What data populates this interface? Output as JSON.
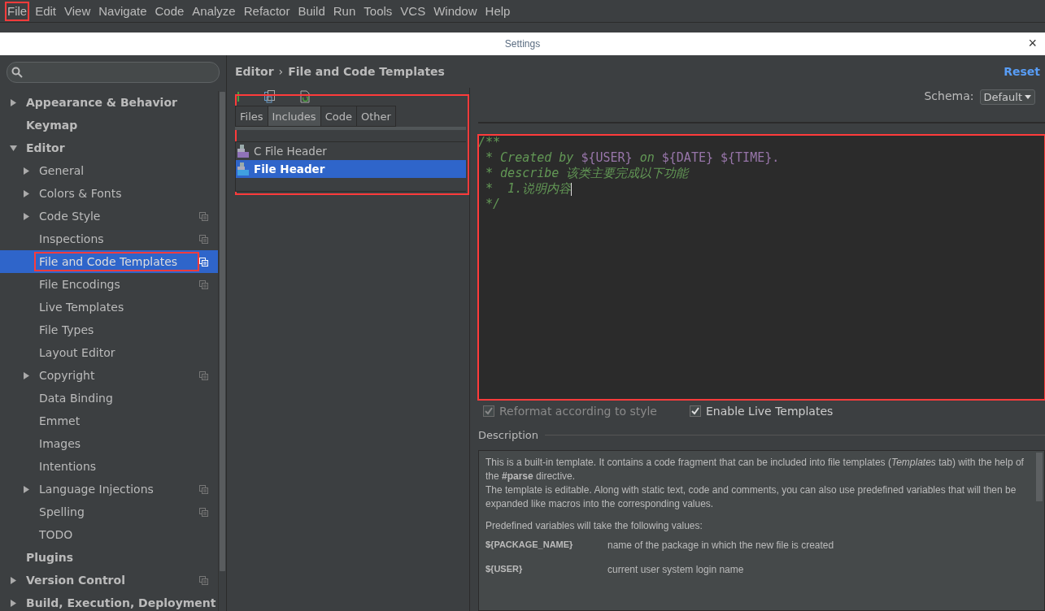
{
  "menu_bar": [
    {
      "label": "File",
      "highlighted": true
    },
    {
      "label": "Edit",
      "highlighted": false
    },
    {
      "label": "View",
      "highlighted": false
    },
    {
      "label": "Navigate",
      "highlighted": false
    },
    {
      "label": "Code",
      "highlighted": false
    },
    {
      "label": "Analyze",
      "highlighted": false
    },
    {
      "label": "Refactor",
      "highlighted": false
    },
    {
      "label": "Build",
      "highlighted": false
    },
    {
      "label": "Run",
      "highlighted": false
    },
    {
      "label": "Tools",
      "highlighted": false
    },
    {
      "label": "VCS",
      "highlighted": false
    },
    {
      "label": "Window",
      "highlighted": false
    },
    {
      "label": "Help",
      "highlighted": false
    }
  ],
  "dialog": {
    "title": "Settings",
    "close": "×"
  },
  "sidebar": {
    "items": [
      {
        "label": "Appearance & Behavior",
        "expanded": false,
        "selected": false,
        "project_icon": false,
        "highlighted": false
      },
      {
        "label": "Keymap",
        "selected": false,
        "project_icon": false,
        "highlighted": false
      },
      {
        "label": "Editor",
        "expanded": true,
        "selected": false,
        "project_icon": false,
        "highlighted": false,
        "children": [
          {
            "label": "General",
            "expanded": false,
            "selected": false,
            "project_icon": false,
            "highlighted": false
          },
          {
            "label": "Colors & Fonts",
            "expanded": false,
            "selected": false,
            "project_icon": false,
            "highlighted": false
          },
          {
            "label": "Code Style",
            "expanded": false,
            "selected": false,
            "project_icon": true,
            "highlighted": false
          },
          {
            "label": "Inspections",
            "selected": false,
            "project_icon": true,
            "highlighted": false
          },
          {
            "label": "File and Code Templates",
            "selected": true,
            "project_icon": true,
            "highlighted": true
          },
          {
            "label": "File Encodings",
            "selected": false,
            "project_icon": true,
            "highlighted": false
          },
          {
            "label": "Live Templates",
            "selected": false,
            "project_icon": false,
            "highlighted": false
          },
          {
            "label": "File Types",
            "selected": false,
            "project_icon": false,
            "highlighted": false
          },
          {
            "label": "Layout Editor",
            "selected": false,
            "project_icon": false,
            "highlighted": false
          },
          {
            "label": "Copyright",
            "expanded": false,
            "selected": false,
            "project_icon": true,
            "highlighted": false
          },
          {
            "label": "Data Binding",
            "selected": false,
            "project_icon": false,
            "highlighted": false
          },
          {
            "label": "Emmet",
            "selected": false,
            "project_icon": false,
            "highlighted": false
          },
          {
            "label": "Images",
            "selected": false,
            "project_icon": false,
            "highlighted": false
          },
          {
            "label": "Intentions",
            "selected": false,
            "project_icon": false,
            "highlighted": false
          },
          {
            "label": "Language Injections",
            "expanded": false,
            "selected": false,
            "project_icon": true,
            "highlighted": false
          },
          {
            "label": "Spelling",
            "selected": false,
            "project_icon": true,
            "highlighted": false
          },
          {
            "label": "TODO",
            "selected": false,
            "project_icon": false,
            "highlighted": false
          }
        ]
      },
      {
        "label": "Plugins",
        "selected": false,
        "project_icon": false,
        "highlighted": false
      },
      {
        "label": "Version Control",
        "expanded": false,
        "selected": false,
        "project_icon": true,
        "highlighted": false
      },
      {
        "label": "Build, Execution, Deployment",
        "expanded": false,
        "selected": false,
        "project_icon": false,
        "highlighted": false
      }
    ]
  },
  "breadcrumb": {
    "parent": "Editor",
    "separator": "›",
    "current": "File and Code Templates"
  },
  "reset": "Reset",
  "schema": {
    "label": "Schema:",
    "value": "Default"
  },
  "tabs": {
    "highlighted": true,
    "items": [
      {
        "label": "Files",
        "selected": false
      },
      {
        "label": "Includes",
        "selected": true
      },
      {
        "label": "Code",
        "selected": false
      },
      {
        "label": "Other",
        "selected": false
      }
    ]
  },
  "templates": [
    {
      "label": "C File Header",
      "kind": "cpp",
      "selected": false
    },
    {
      "label": "File Header",
      "kind": "java",
      "selected": true
    }
  ],
  "editor": {
    "highlighted": true,
    "lines": [
      [
        {
          "kind": "comment",
          "text": "/**"
        }
      ],
      [
        {
          "kind": "comment",
          "text": " * Created by "
        },
        {
          "kind": "variable",
          "text": "${USER}"
        },
        {
          "kind": "comment",
          "text": " on "
        },
        {
          "kind": "variable",
          "text": "${DATE} ${TIME}."
        }
      ],
      [
        {
          "kind": "comment",
          "text": " * describe 该类主要完成以下功能"
        }
      ],
      [
        {
          "kind": "comment",
          "text": " *  1.说明内容"
        }
      ],
      [
        {
          "kind": "comment",
          "text": " */"
        }
      ]
    ]
  },
  "options": [
    {
      "label": "Reformat according to style",
      "checked": true,
      "disabled": true
    },
    {
      "label": "Enable Live Templates",
      "checked": true,
      "disabled": false
    }
  ],
  "description": {
    "title": "Description",
    "paragraphs": [
      "This is a built-in template. It contains a code fragment that can be included into file templates (*Templates* tab) with the help of the **#parse** directive.",
      "The template is editable. Along with static text, code and comments, you can also use predefined variables that will then be expanded like macros into the corresponding values."
    ],
    "variables_intro": "Predefined variables will take the following values:",
    "variables": [
      {
        "name": "${PACKAGE_NAME}",
        "meaning": "name of the package in which the new file is created"
      },
      {
        "name": "${USER}",
        "meaning": "current user system login name"
      }
    ]
  }
}
